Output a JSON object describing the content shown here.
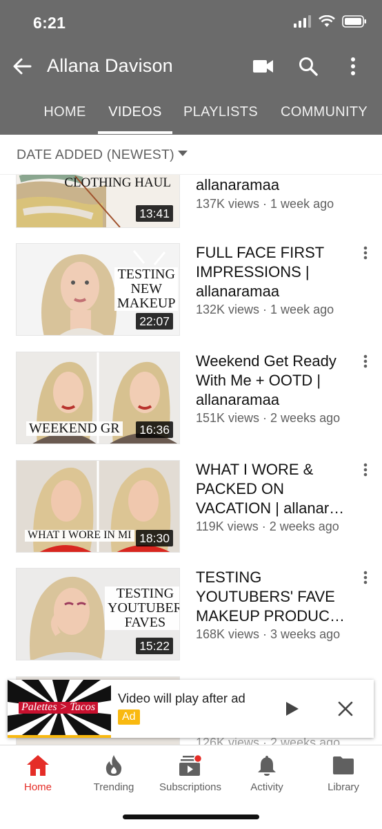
{
  "status_bar": {
    "time": "6:21"
  },
  "header": {
    "channel_title": "Allana Davison",
    "tabs": [
      {
        "label": "HOME",
        "active": false
      },
      {
        "label": "VIDEOS",
        "active": true
      },
      {
        "label": "PLAYLISTS",
        "active": false
      },
      {
        "label": "COMMUNITY",
        "active": false
      }
    ]
  },
  "sort": {
    "label": "DATE ADDED (NEWEST)"
  },
  "videos": [
    {
      "title": "allanaramaa",
      "meta": "137K views · 1 week ago",
      "duration": "13:41",
      "thumb_text": "CLOTHING\nHAUL"
    },
    {
      "title": "FULL FACE FIRST IMPRESSIONS | allanaramaa",
      "meta": "132K views · 1 week ago",
      "duration": "22:07",
      "thumb_text": "TESTING\nNEW\nMAKEUP"
    },
    {
      "title": "Weekend Get Ready With Me + OOTD | allanaramaa",
      "meta": "151K views · 2 weeks ago",
      "duration": "16:36",
      "thumb_text": "WEEKEND GR"
    },
    {
      "title": "WHAT I WORE & PACKED ON VACATION | allanar…",
      "meta": "119K views · 2 weeks ago",
      "duration": "18:30",
      "thumb_text": "WHAT I WORE IN MI"
    },
    {
      "title": "TESTING YOUTUBERS' FAVE MAKEUP PRODUC…",
      "meta": "168K views · 3 weeks ago",
      "duration": "15:22",
      "thumb_text": "TESTING\nYOUTUBER\nFAVES"
    },
    {
      "title": "",
      "meta": "126K views · 2 weeks ago",
      "duration": "",
      "thumb_text": ""
    }
  ],
  "ad": {
    "title": "Video will play after ad",
    "badge": "Ad",
    "thumb_text": "Palettes > Tacos",
    "accent_color": "#f9b910"
  },
  "bottom_nav": [
    {
      "label": "Home",
      "icon": "home-icon",
      "active": true
    },
    {
      "label": "Trending",
      "icon": "flame-icon",
      "active": false
    },
    {
      "label": "Subscriptions",
      "icon": "subscriptions-icon",
      "active": false
    },
    {
      "label": "Activity",
      "icon": "bell-icon",
      "active": false
    },
    {
      "label": "Library",
      "icon": "folder-icon",
      "active": false
    }
  ],
  "colors": {
    "header_bg": "#6b6b6b",
    "brand_red": "#e52d27",
    "meta_gray": "#606060"
  }
}
